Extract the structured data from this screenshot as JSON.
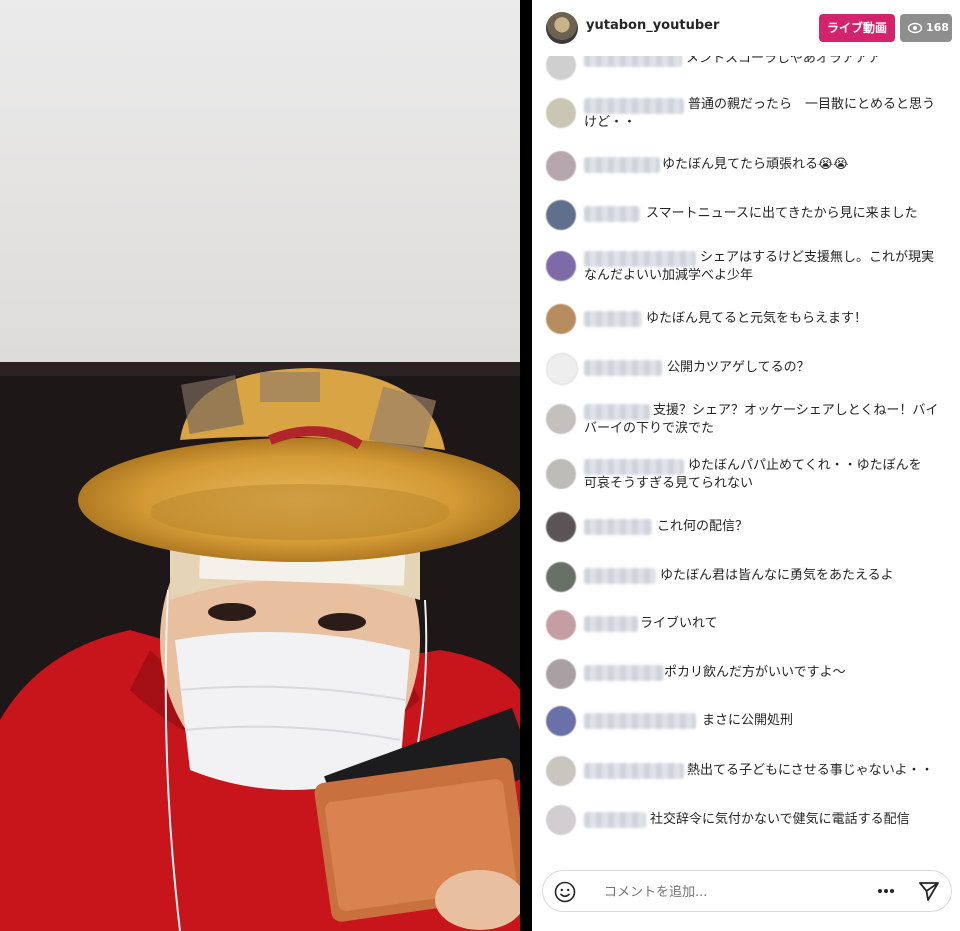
{
  "header": {
    "username": "yutabon_youtuber",
    "live_label": "ライブ動画",
    "viewer_count": "168"
  },
  "comments": [
    {
      "line1": "メントスコーラしやあオラアアア",
      "line2": ""
    },
    {
      "line1": "普通の親だったら　一目散にとめると思う",
      "line2": "けど・・"
    },
    {
      "line1": "ゆたぼん見てたら頑張れる😭😭",
      "line2": ""
    },
    {
      "line1": "スマートニュースに出てきたから見に来ました",
      "line2": ""
    },
    {
      "line1": "シェアはするけど支援無し。これが現実",
      "line2": "なんだよいい加減学べよ少年"
    },
    {
      "line1": "ゆたぼん見てると元気をもらえます！",
      "line2": ""
    },
    {
      "line1": "公開カツアゲしてるの？",
      "line2": ""
    },
    {
      "line1": "支援？シェア？オッケーシェアしとくねー！バイ",
      "line2": "バーイの下りで涙でた"
    },
    {
      "line1": "ゆたぼんパパ止めてくれ・・ゆたぼんを",
      "line2": "可哀そうすぎる見てられない"
    },
    {
      "line1": "これ何の配信？",
      "line2": ""
    },
    {
      "line1": "ゆたぼん君は皆んなに勇気をあたえるよ",
      "line2": ""
    },
    {
      "line1": "ライブいれて",
      "line2": ""
    },
    {
      "line1": "ポカリ飲んだ方がいいですよ〜",
      "line2": ""
    },
    {
      "line1": "まさに公開処刑",
      "line2": ""
    },
    {
      "line1": "熱出てる子どもにさせる事じゃないよ・・",
      "line2": ""
    },
    {
      "line1": "社交辞令に気付かないで健気に電話する配信",
      "line2": ""
    }
  ],
  "footer": {
    "comment_placeholder": "コメントを追加...",
    "more_icon": "more-dots-icon",
    "send_icon": "send-icon",
    "emoji_icon": "smile-icon"
  },
  "colors": {
    "live_badge": "#d3236d",
    "viewer_badge": "#8e8e8e",
    "text": "#262626"
  }
}
